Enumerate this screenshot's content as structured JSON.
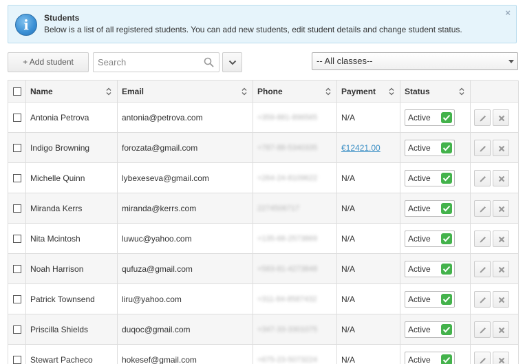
{
  "banner": {
    "icon": "info-icon",
    "title": "Students",
    "text": "Below is a list of all registered students. You can add new students, edit student details and change student status.",
    "close": "×"
  },
  "toolbar": {
    "add_label": "+ Add student",
    "search_placeholder": "Search",
    "class_filter": "-- All classes--"
  },
  "table": {
    "headers": {
      "name": "Name",
      "email": "Email",
      "phone": "Phone",
      "payment": "Payment",
      "status": "Status"
    },
    "rows": [
      {
        "name": "Antonia Petrova",
        "email": "antonia@petrova.com",
        "phone": "+359-881-896565",
        "payment": "N/A",
        "payment_link": false,
        "status": "Active"
      },
      {
        "name": "Indigo Browning",
        "email": "forozata@gmail.com",
        "phone": "+787-88-5340335",
        "payment": "€12421.00",
        "payment_link": true,
        "status": "Active"
      },
      {
        "name": "Michelle Quinn",
        "email": "lybexeseva@gmail.com",
        "phone": "+264-24-8109622",
        "payment": "N/A",
        "payment_link": false,
        "status": "Active"
      },
      {
        "name": "Miranda Kerrs",
        "email": "miranda@kerrs.com",
        "phone": "2274506717",
        "payment": "N/A",
        "payment_link": false,
        "status": "Active"
      },
      {
        "name": "Nita Mcintosh",
        "email": "luwuc@yahoo.com",
        "phone": "+135-68-2573869",
        "payment": "N/A",
        "payment_link": false,
        "status": "Active"
      },
      {
        "name": "Noah Harrison",
        "email": "qufuza@gmail.com",
        "phone": "+583-81-4273848",
        "payment": "N/A",
        "payment_link": false,
        "status": "Active"
      },
      {
        "name": "Patrick Townsend",
        "email": "liru@yahoo.com",
        "phone": "+311-84-8587432",
        "payment": "N/A",
        "payment_link": false,
        "status": "Active"
      },
      {
        "name": "Priscilla Shields",
        "email": "duqoc@gmail.com",
        "phone": "+347-33-3301075",
        "payment": "N/A",
        "payment_link": false,
        "status": "Active"
      },
      {
        "name": "Stewart Pacheco",
        "email": "hokesef@gmail.com",
        "phone": "+675-23-5073224",
        "payment": "N/A",
        "payment_link": false,
        "status": "Active"
      }
    ]
  },
  "colors": {
    "accent_link": "#3b8fc5",
    "status_active": "#43b24b",
    "banner_bg": "#e6f4fb"
  }
}
